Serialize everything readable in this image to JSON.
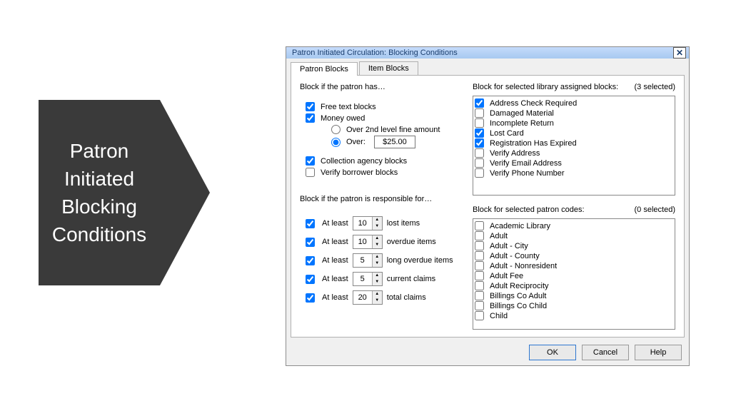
{
  "callout": {
    "title": "Patron\nInitiated\nBlocking\nConditions"
  },
  "dialog": {
    "title": "Patron Initiated Circulation: Blocking Conditions",
    "tabs": [
      {
        "label": "Patron Blocks",
        "active": true
      },
      {
        "label": "Item Blocks",
        "active": false
      }
    ],
    "section_has_label": "Block if the patron has…",
    "has_checks": {
      "free_text": {
        "label": "Free text blocks",
        "checked": true
      },
      "money_owed": {
        "label": "Money owed",
        "checked": true
      },
      "collection_agency": {
        "label": "Collection agency blocks",
        "checked": true
      },
      "verify_borrower": {
        "label": "Verify borrower blocks",
        "checked": false
      }
    },
    "money_radios": {
      "over_2nd": {
        "label": "Over 2nd level fine amount",
        "selected": false
      },
      "over": {
        "label": "Over:",
        "selected": true,
        "amount": "$25.00"
      }
    },
    "section_responsible_label": "Block if the patron is responsible for…",
    "responsible": [
      {
        "checked": true,
        "prefix": "At least",
        "value": "10",
        "suffix": "lost items"
      },
      {
        "checked": true,
        "prefix": "At least",
        "value": "10",
        "suffix": "overdue items"
      },
      {
        "checked": true,
        "prefix": "At least",
        "value": "5",
        "suffix": "long overdue items"
      },
      {
        "checked": true,
        "prefix": "At least",
        "value": "5",
        "suffix": "current claims"
      },
      {
        "checked": true,
        "prefix": "At least",
        "value": "20",
        "suffix": "total claims"
      }
    ],
    "library_blocks": {
      "label": "Block for selected library assigned blocks:",
      "count": "(3 selected)",
      "items": [
        {
          "label": "Address Check Required",
          "checked": true
        },
        {
          "label": "Damaged Material",
          "checked": false
        },
        {
          "label": "Incomplete Return",
          "checked": false
        },
        {
          "label": "Lost Card",
          "checked": true
        },
        {
          "label": "Registration Has Expired",
          "checked": true
        },
        {
          "label": "Verify Address",
          "checked": false
        },
        {
          "label": "Verify Email Address",
          "checked": false
        },
        {
          "label": "Verify Phone Number",
          "checked": false
        }
      ]
    },
    "patron_codes": {
      "label": "Block for selected patron codes:",
      "count": "(0 selected)",
      "items": [
        {
          "label": "Academic Library",
          "checked": false
        },
        {
          "label": "Adult",
          "checked": false
        },
        {
          "label": "Adult - City",
          "checked": false
        },
        {
          "label": "Adult - County",
          "checked": false
        },
        {
          "label": "Adult - Nonresident",
          "checked": false
        },
        {
          "label": "Adult Fee",
          "checked": false
        },
        {
          "label": "Adult Reciprocity",
          "checked": false
        },
        {
          "label": "Billings Co Adult",
          "checked": false
        },
        {
          "label": "Billings Co Child",
          "checked": false
        },
        {
          "label": "Child",
          "checked": false
        }
      ]
    },
    "buttons": {
      "ok": "OK",
      "cancel": "Cancel",
      "help": "Help"
    }
  }
}
